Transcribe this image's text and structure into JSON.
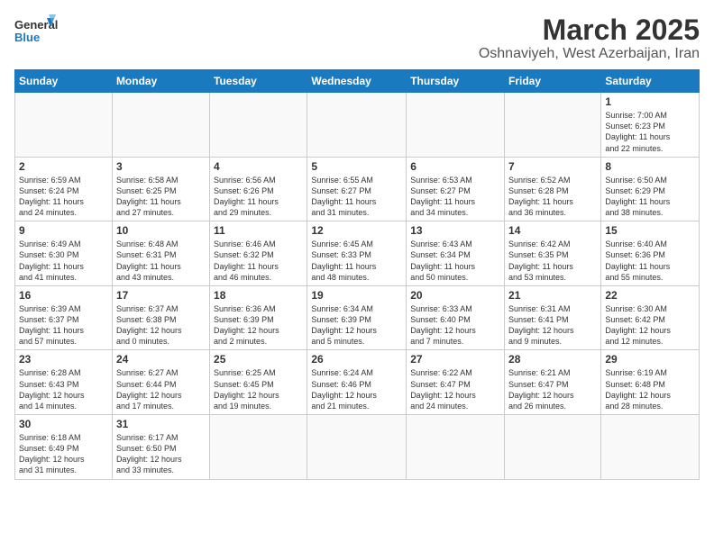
{
  "header": {
    "logo_general": "General",
    "logo_blue": "Blue",
    "month": "March 2025",
    "location": "Oshnaviyeh, West Azerbaijan, Iran"
  },
  "days_of_week": [
    "Sunday",
    "Monday",
    "Tuesday",
    "Wednesday",
    "Thursday",
    "Friday",
    "Saturday"
  ],
  "weeks": [
    [
      {
        "day": "",
        "info": ""
      },
      {
        "day": "",
        "info": ""
      },
      {
        "day": "",
        "info": ""
      },
      {
        "day": "",
        "info": ""
      },
      {
        "day": "",
        "info": ""
      },
      {
        "day": "",
        "info": ""
      },
      {
        "day": "1",
        "info": "Sunrise: 7:00 AM\nSunset: 6:23 PM\nDaylight: 11 hours\nand 22 minutes."
      }
    ],
    [
      {
        "day": "2",
        "info": "Sunrise: 6:59 AM\nSunset: 6:24 PM\nDaylight: 11 hours\nand 24 minutes."
      },
      {
        "day": "3",
        "info": "Sunrise: 6:58 AM\nSunset: 6:25 PM\nDaylight: 11 hours\nand 27 minutes."
      },
      {
        "day": "4",
        "info": "Sunrise: 6:56 AM\nSunset: 6:26 PM\nDaylight: 11 hours\nand 29 minutes."
      },
      {
        "day": "5",
        "info": "Sunrise: 6:55 AM\nSunset: 6:27 PM\nDaylight: 11 hours\nand 31 minutes."
      },
      {
        "day": "6",
        "info": "Sunrise: 6:53 AM\nSunset: 6:27 PM\nDaylight: 11 hours\nand 34 minutes."
      },
      {
        "day": "7",
        "info": "Sunrise: 6:52 AM\nSunset: 6:28 PM\nDaylight: 11 hours\nand 36 minutes."
      },
      {
        "day": "8",
        "info": "Sunrise: 6:50 AM\nSunset: 6:29 PM\nDaylight: 11 hours\nand 38 minutes."
      }
    ],
    [
      {
        "day": "9",
        "info": "Sunrise: 6:49 AM\nSunset: 6:30 PM\nDaylight: 11 hours\nand 41 minutes."
      },
      {
        "day": "10",
        "info": "Sunrise: 6:48 AM\nSunset: 6:31 PM\nDaylight: 11 hours\nand 43 minutes."
      },
      {
        "day": "11",
        "info": "Sunrise: 6:46 AM\nSunset: 6:32 PM\nDaylight: 11 hours\nand 46 minutes."
      },
      {
        "day": "12",
        "info": "Sunrise: 6:45 AM\nSunset: 6:33 PM\nDaylight: 11 hours\nand 48 minutes."
      },
      {
        "day": "13",
        "info": "Sunrise: 6:43 AM\nSunset: 6:34 PM\nDaylight: 11 hours\nand 50 minutes."
      },
      {
        "day": "14",
        "info": "Sunrise: 6:42 AM\nSunset: 6:35 PM\nDaylight: 11 hours\nand 53 minutes."
      },
      {
        "day": "15",
        "info": "Sunrise: 6:40 AM\nSunset: 6:36 PM\nDaylight: 11 hours\nand 55 minutes."
      }
    ],
    [
      {
        "day": "16",
        "info": "Sunrise: 6:39 AM\nSunset: 6:37 PM\nDaylight: 11 hours\nand 57 minutes."
      },
      {
        "day": "17",
        "info": "Sunrise: 6:37 AM\nSunset: 6:38 PM\nDaylight: 12 hours\nand 0 minutes."
      },
      {
        "day": "18",
        "info": "Sunrise: 6:36 AM\nSunset: 6:39 PM\nDaylight: 12 hours\nand 2 minutes."
      },
      {
        "day": "19",
        "info": "Sunrise: 6:34 AM\nSunset: 6:39 PM\nDaylight: 12 hours\nand 5 minutes."
      },
      {
        "day": "20",
        "info": "Sunrise: 6:33 AM\nSunset: 6:40 PM\nDaylight: 12 hours\nand 7 minutes."
      },
      {
        "day": "21",
        "info": "Sunrise: 6:31 AM\nSunset: 6:41 PM\nDaylight: 12 hours\nand 9 minutes."
      },
      {
        "day": "22",
        "info": "Sunrise: 6:30 AM\nSunset: 6:42 PM\nDaylight: 12 hours\nand 12 minutes."
      }
    ],
    [
      {
        "day": "23",
        "info": "Sunrise: 6:28 AM\nSunset: 6:43 PM\nDaylight: 12 hours\nand 14 minutes."
      },
      {
        "day": "24",
        "info": "Sunrise: 6:27 AM\nSunset: 6:44 PM\nDaylight: 12 hours\nand 17 minutes."
      },
      {
        "day": "25",
        "info": "Sunrise: 6:25 AM\nSunset: 6:45 PM\nDaylight: 12 hours\nand 19 minutes."
      },
      {
        "day": "26",
        "info": "Sunrise: 6:24 AM\nSunset: 6:46 PM\nDaylight: 12 hours\nand 21 minutes."
      },
      {
        "day": "27",
        "info": "Sunrise: 6:22 AM\nSunset: 6:47 PM\nDaylight: 12 hours\nand 24 minutes."
      },
      {
        "day": "28",
        "info": "Sunrise: 6:21 AM\nSunset: 6:47 PM\nDaylight: 12 hours\nand 26 minutes."
      },
      {
        "day": "29",
        "info": "Sunrise: 6:19 AM\nSunset: 6:48 PM\nDaylight: 12 hours\nand 28 minutes."
      }
    ],
    [
      {
        "day": "30",
        "info": "Sunrise: 6:18 AM\nSunset: 6:49 PM\nDaylight: 12 hours\nand 31 minutes."
      },
      {
        "day": "31",
        "info": "Sunrise: 6:17 AM\nSunset: 6:50 PM\nDaylight: 12 hours\nand 33 minutes."
      },
      {
        "day": "",
        "info": ""
      },
      {
        "day": "",
        "info": ""
      },
      {
        "day": "",
        "info": ""
      },
      {
        "day": "",
        "info": ""
      },
      {
        "day": "",
        "info": ""
      }
    ]
  ]
}
